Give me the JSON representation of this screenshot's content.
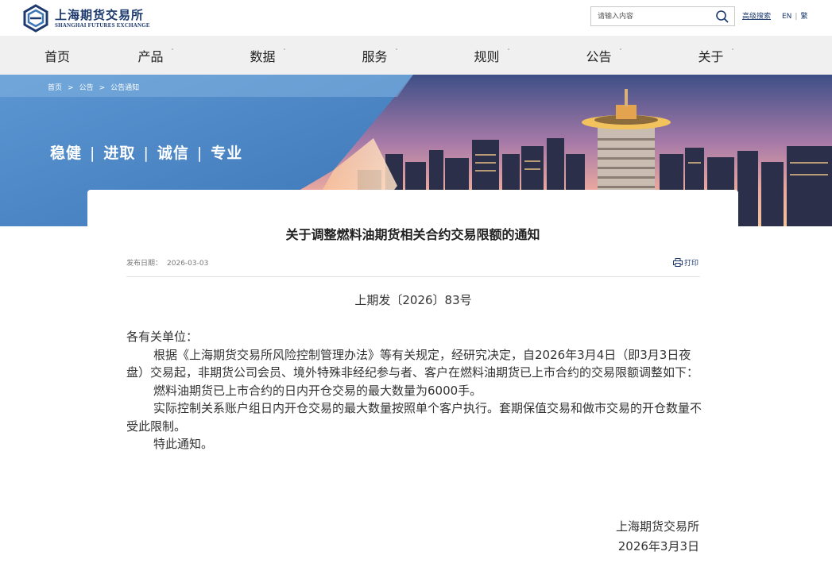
{
  "header": {
    "logo_cn": "上海期货交易所",
    "logo_en": "SHANGHAI FUTURES EXCHANGE",
    "search_placeholder": "请输入内容",
    "advanced_search": "高级搜索",
    "lang_en": "EN",
    "lang_trad": "繁"
  },
  "nav": [
    {
      "label": "首页"
    },
    {
      "label": "产品",
      "caret": "˙"
    },
    {
      "label": "数据",
      "caret": "˙"
    },
    {
      "label": "服务",
      "caret": "˙"
    },
    {
      "label": "规则",
      "caret": "˙"
    },
    {
      "label": "公告",
      "caret": "˙"
    },
    {
      "label": "关于",
      "caret": "˙"
    }
  ],
  "breadcrumb": [
    "首页",
    "公告",
    "公告通知"
  ],
  "breadcrumb_sep": ">",
  "slogan": [
    "稳健",
    "进取",
    "诚信",
    "专业"
  ],
  "slogan_sep": "|",
  "article": {
    "title": "关于调整燃料油期货相关合约交易限额的通知",
    "date_label": "发布日期：",
    "date": "2026-03-03",
    "print_label": "打印",
    "doc_no": "上期发〔2026〕83号",
    "salutation": "各有关单位：",
    "paragraphs": [
      "根据《上海期货交易所风险控制管理办法》等有关规定，经研究决定，自2026年3月4日（即3月3日夜盘）交易起，非期货公司会员、境外特殊非经纪参与者、客户在燃料油期货已上市合约的交易限额调整如下：",
      "燃料油期货已上市合约的日内开仓交易的最大数量为6000手。",
      "实际控制关系账户组日内开仓交易的最大数量按照单个客户执行。套期保值交易和做市交易的开仓数量不受此限制。",
      "特此通知。"
    ],
    "signature": "上海期货交易所",
    "sign_date": "2026年3月3日"
  },
  "colors": {
    "brand": "#1d3a6e",
    "nav_bg": "#f0f0f0",
    "banner_blue": "#4a86c8"
  }
}
